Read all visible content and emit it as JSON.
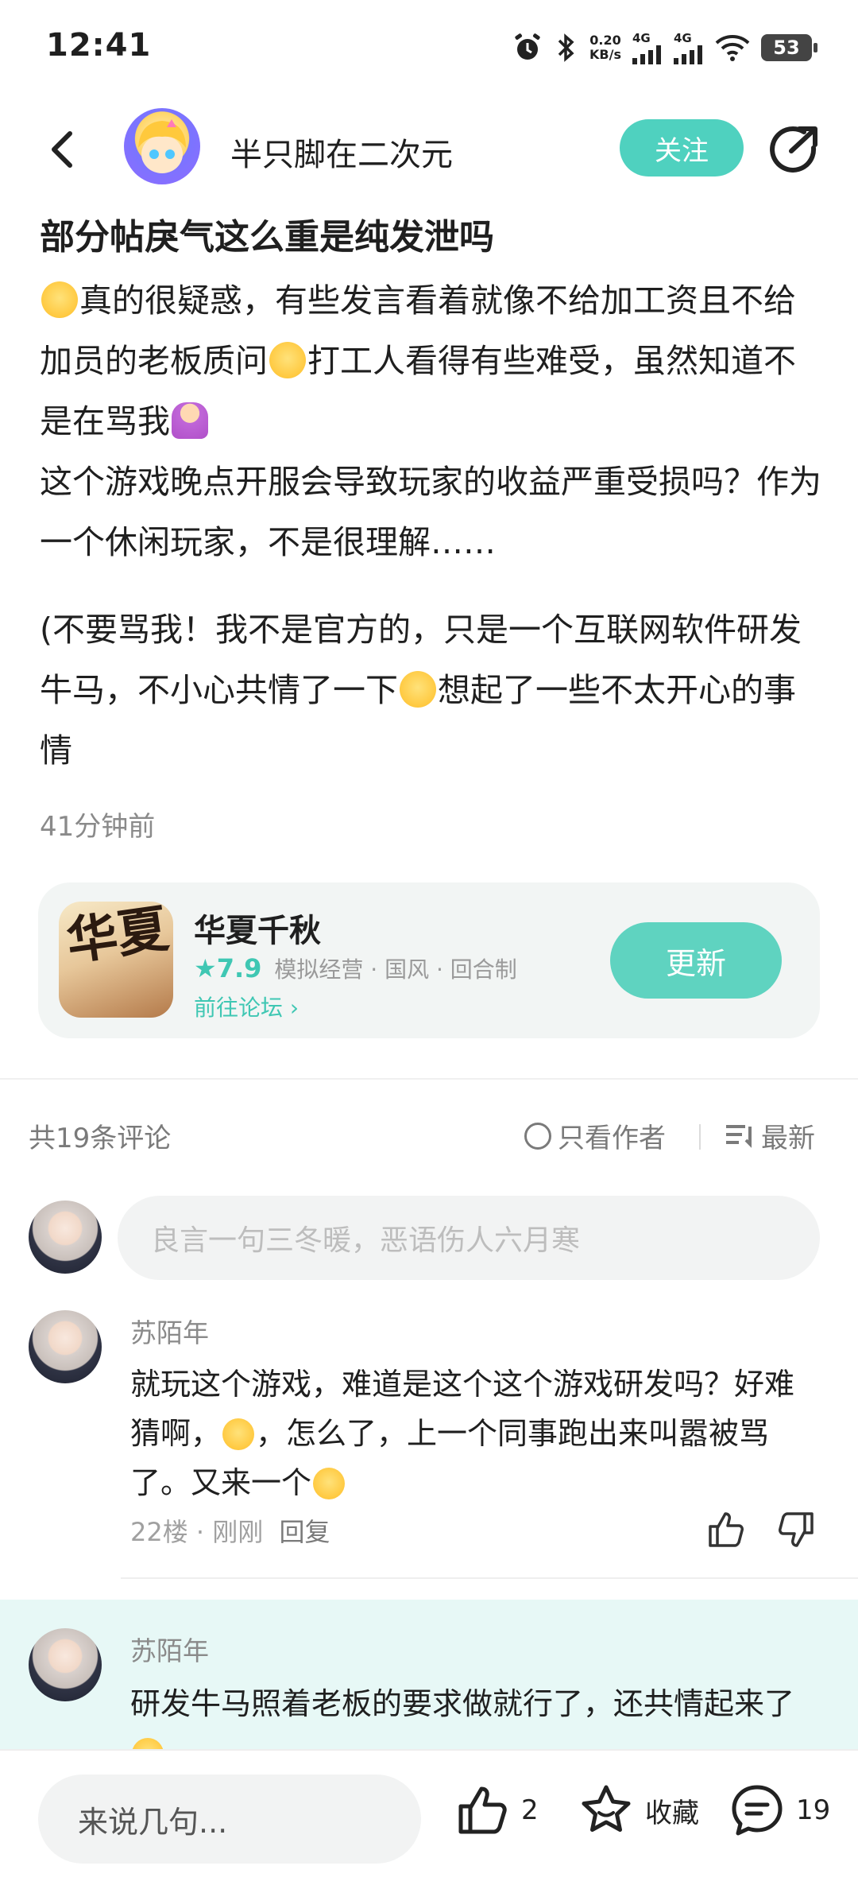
{
  "status_bar": {
    "time": "12:41",
    "net_speed_value": "0.20",
    "net_speed_unit": "KB/s",
    "signal_1": "4G",
    "signal_2": "4G",
    "battery": "53"
  },
  "header": {
    "author_name": "半只脚在二次元",
    "follow_label": "关注",
    "accent_color": "#4fd1bf"
  },
  "post": {
    "title": "部分帖戾气这么重是纯发泄吗",
    "p1_a": "真的很疑惑，有些发言看着就像不给加工资且不给加员的老板质问",
    "p1_b": "打工人看得有些难受，虽然知道不是在骂我",
    "p2": "这个游戏晚点开服会导致玩家的收益严重受损吗？作为一个休闲玩家，不是很理解……",
    "p3_a": "(不要骂我！我不是官方的，只是一个互联网软件研发牛马，不小心共情了一下",
    "p3_b": "想起了一些不太开心的事情",
    "time_ago": "41分钟前"
  },
  "game_card": {
    "icon_text": "华夏",
    "name": "华夏千秋",
    "rating": "7.9",
    "tags": "模拟经营 · 国风 · 回合制",
    "forum_link": "前往论坛",
    "update_label": "更新"
  },
  "comments_header": {
    "count_label": "共19条评论",
    "author_only_label": "只看作者",
    "sort_label": "最新"
  },
  "comment_input": {
    "placeholder": "良言一句三冬暖，恶语伤人六月寒"
  },
  "comments": [
    {
      "user": "苏陌年",
      "text_a": "就玩这个游戏，难道是这个这个游戏研发吗？好难猜啊，",
      "text_b": "，怎么了，上一个同事跑出来叫嚣被骂了。又来一个",
      "floor": "22楼",
      "time": "刚刚",
      "reply_label": "回复"
    },
    {
      "user": "苏陌年",
      "text": "研发牛马照着老板的要求做就行了，还共情起来了"
    }
  ],
  "bottom_bar": {
    "input_placeholder": "来说几句...",
    "like_count": "2",
    "favorite_label": "收藏",
    "comment_count": "19"
  }
}
